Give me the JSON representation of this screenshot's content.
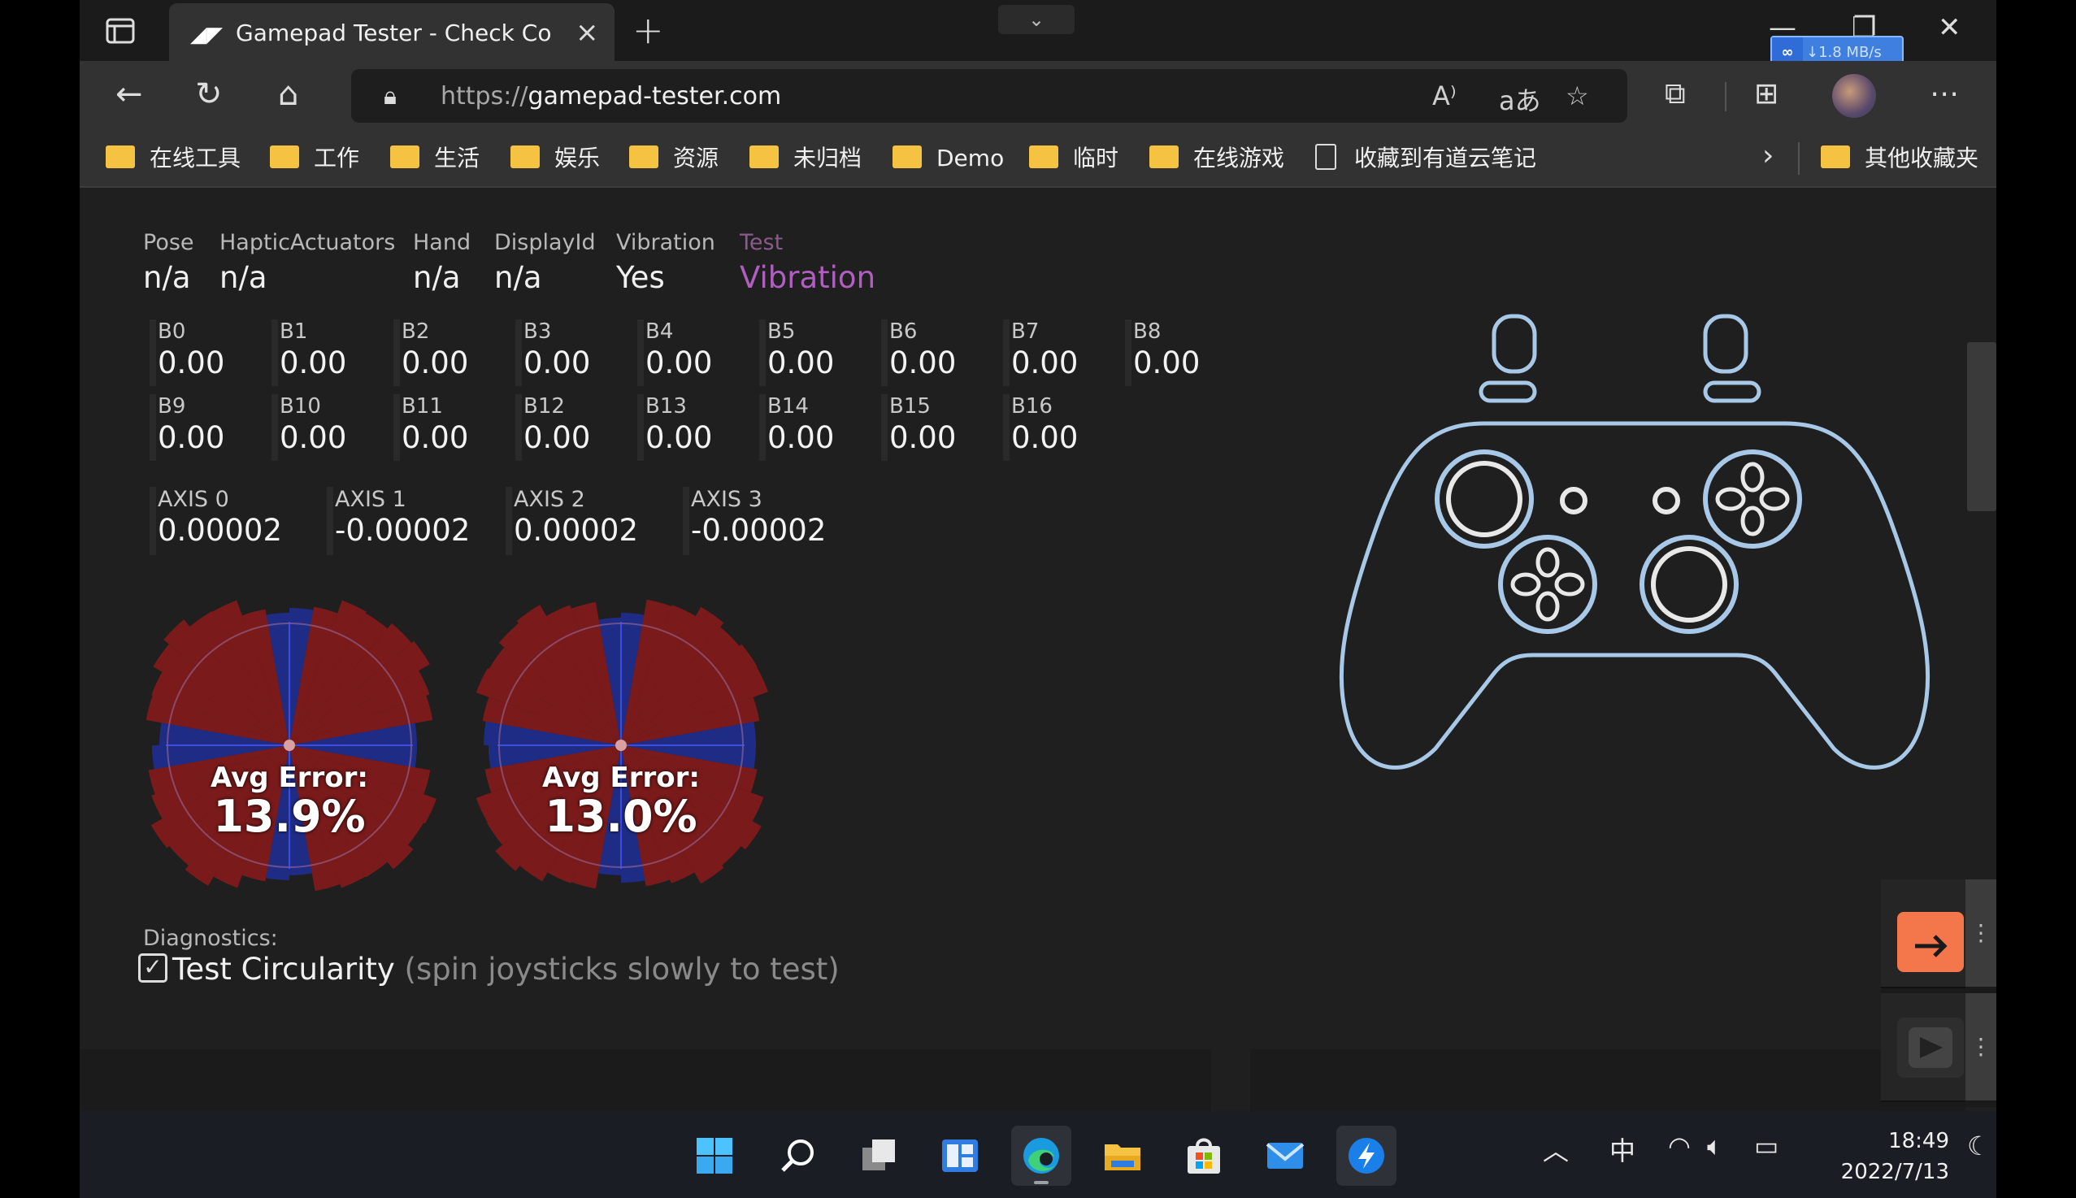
{
  "browser": {
    "tab_title": "Gamepad Tester - Check Controll",
    "url_protocol": "https://",
    "url_host": "gamepad-tester.com",
    "download_speed": "↓1.8 MB/s"
  },
  "bookmarks": [
    {
      "label": "在线工具",
      "type": "folder"
    },
    {
      "label": "工作",
      "type": "folder"
    },
    {
      "label": "生活",
      "type": "folder"
    },
    {
      "label": "娱乐",
      "type": "folder"
    },
    {
      "label": "资源",
      "type": "folder"
    },
    {
      "label": "未归档",
      "type": "folder"
    },
    {
      "label": "Demo",
      "type": "folder"
    },
    {
      "label": "临时",
      "type": "folder"
    },
    {
      "label": "在线游戏",
      "type": "folder"
    },
    {
      "label": "收藏到有道云笔记",
      "type": "page"
    }
  ],
  "other_bookmarks": "其他收藏夹",
  "gamepad": {
    "meta": [
      {
        "key": "Pose",
        "value": "n/a"
      },
      {
        "key": "HapticActuators",
        "value": "n/a"
      },
      {
        "key": "Hand",
        "value": "n/a"
      },
      {
        "key": "DisplayId",
        "value": "n/a"
      },
      {
        "key": "Vibration",
        "value": "Yes"
      },
      {
        "key": "Test",
        "value": "Vibration"
      }
    ],
    "buttons": [
      {
        "label": "B0",
        "value": "0.00"
      },
      {
        "label": "B1",
        "value": "0.00"
      },
      {
        "label": "B2",
        "value": "0.00"
      },
      {
        "label": "B3",
        "value": "0.00"
      },
      {
        "label": "B4",
        "value": "0.00"
      },
      {
        "label": "B5",
        "value": "0.00"
      },
      {
        "label": "B6",
        "value": "0.00"
      },
      {
        "label": "B7",
        "value": "0.00"
      },
      {
        "label": "B8",
        "value": "0.00"
      },
      {
        "label": "B9",
        "value": "0.00"
      },
      {
        "label": "B10",
        "value": "0.00"
      },
      {
        "label": "B11",
        "value": "0.00"
      },
      {
        "label": "B12",
        "value": "0.00"
      },
      {
        "label": "B13",
        "value": "0.00"
      },
      {
        "label": "B14",
        "value": "0.00"
      },
      {
        "label": "B15",
        "value": "0.00"
      },
      {
        "label": "B16",
        "value": "0.00"
      }
    ],
    "axes": [
      {
        "label": "AXIS 0",
        "value": "0.00002"
      },
      {
        "label": "AXIS 1",
        "value": "-0.00002"
      },
      {
        "label": "AXIS 2",
        "value": "0.00002"
      },
      {
        "label": "AXIS 3",
        "value": "-0.00002"
      }
    ],
    "circularity": [
      {
        "label": "Avg Error:",
        "value": "13.9%"
      },
      {
        "label": "Avg Error:",
        "value": "13.0%"
      }
    ],
    "diagnostics_label": "Diagnostics:",
    "test_circularity": {
      "label": "Test Circularity",
      "hint": "(spin joysticks slowly to test)",
      "checked": true
    }
  },
  "taskbar": {
    "ime": "中",
    "time": "18:49",
    "date": "2022/7/13"
  },
  "colors": {
    "accent_purple": "#b05fc0",
    "controller_outline": "#a8c8e8",
    "error_red": "#8b1a1a",
    "ok_blue": "#1f2fa0"
  }
}
